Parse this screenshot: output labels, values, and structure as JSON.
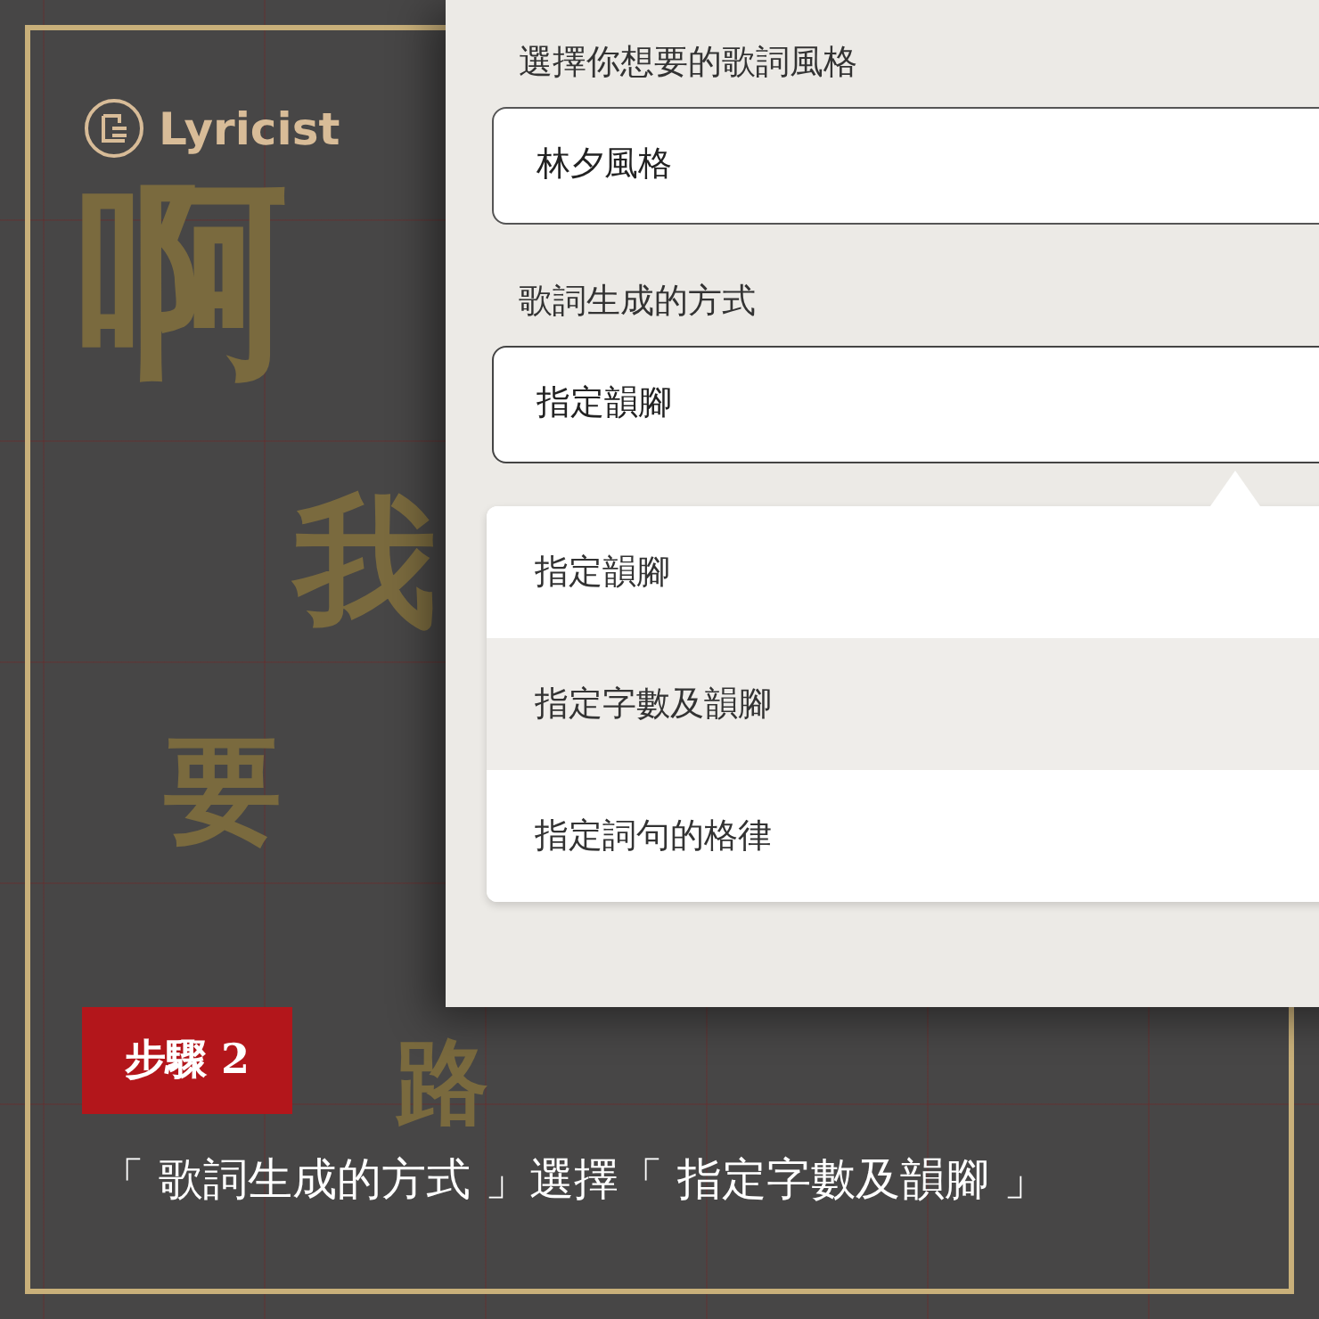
{
  "brand": {
    "name": "Lyricist"
  },
  "background_glyphs": [
    "啊",
    "我",
    "要",
    "路"
  ],
  "form": {
    "fields": [
      {
        "label": "選擇你想要的歌詞風格",
        "value": "林夕風格",
        "expanded": false
      },
      {
        "label": "歌詞生成的方式",
        "value": "指定韻腳",
        "expanded": true
      }
    ],
    "menu": [
      {
        "label": "指定韻腳",
        "selected": false
      },
      {
        "label": "指定字數及韻腳",
        "selected": true
      },
      {
        "label": "指定詞句的格律",
        "selected": false
      }
    ]
  },
  "step": {
    "badge": "步驟 2",
    "caption": "「 歌詞生成的方式 」選擇「 指定字數及韻腳 」"
  }
}
